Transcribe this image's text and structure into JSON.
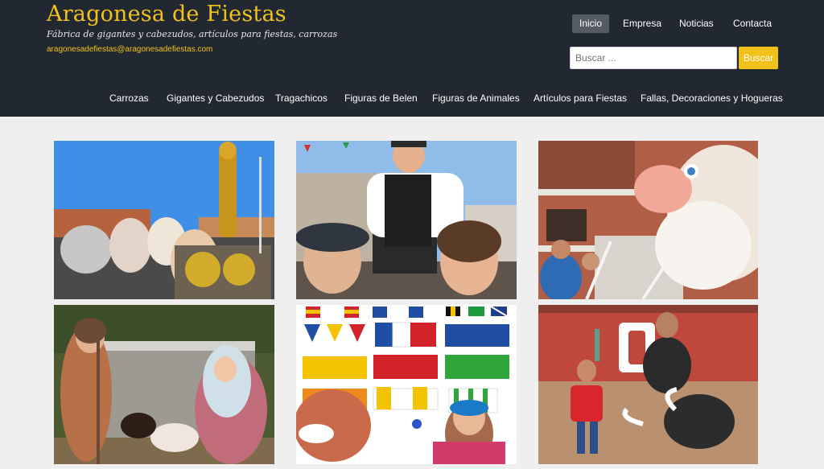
{
  "site": {
    "title": "Aragonesa de Fiestas",
    "tagline": "Fábrica de gigantes y cabezudos, artículos para fiestas, carrozas",
    "email": "aragonesadefiestas@aragonesadefiestas.com"
  },
  "top_nav": [
    {
      "label": "Inicio",
      "active": true
    },
    {
      "label": "Empresa"
    },
    {
      "label": "Noticias"
    },
    {
      "label": "Contacta"
    }
  ],
  "search": {
    "placeholder": "Buscar ...",
    "button_label": "Buscar"
  },
  "main_nav": [
    {
      "label": "Carrozas"
    },
    {
      "label": "Gigantes y Cabezudos"
    },
    {
      "label": "Tragachicos"
    },
    {
      "label": "Figuras de Belen"
    },
    {
      "label": "Figuras de Animales"
    },
    {
      "label": "Artículos para Fiestas"
    },
    {
      "label": "Fallas, Decoraciones y Hogueras"
    }
  ],
  "gallery": [
    {
      "subject": "carroza-parade-float"
    },
    {
      "subject": "gigantes-y-cabezudos"
    },
    {
      "subject": "cabezudo-figure"
    },
    {
      "subject": "belen-nativity-figures"
    },
    {
      "subject": "articulos-para-fiestas"
    },
    {
      "subject": "toro-bull-figure"
    }
  ],
  "colors": {
    "header_bg": "#222831",
    "accent": "#f2c21a",
    "page_bg": "#efefef",
    "active_nav_bg": "#555b63"
  }
}
